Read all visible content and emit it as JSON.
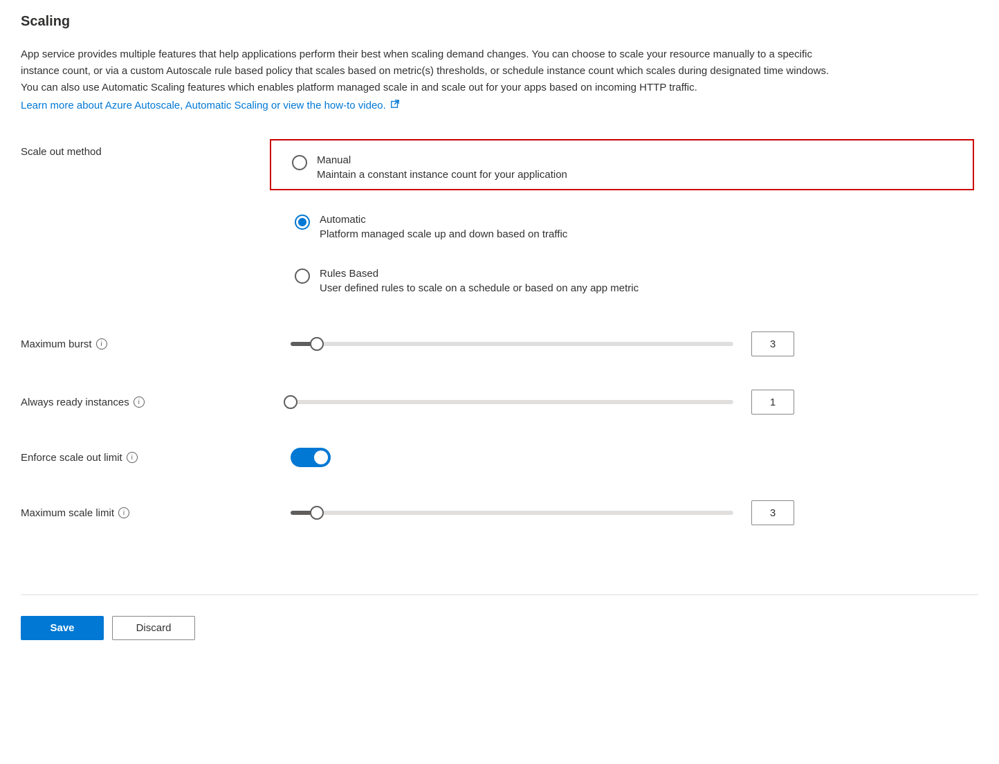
{
  "title": "Scaling",
  "description": "App service provides multiple features that help applications perform their best when scaling demand changes. You can choose to scale your resource manually to a specific instance count, or via a custom Autoscale rule based policy that scales based on metric(s) thresholds, or schedule instance count which scales during designated time windows. You can also use Automatic Scaling features which enables platform managed scale in and scale out for your apps based on incoming HTTP traffic.",
  "learn_more": "Learn more about Azure Autoscale, Automatic Scaling or view the how-to video.",
  "scale_out_method": {
    "label": "Scale out method",
    "options": [
      {
        "title": "Manual",
        "desc": "Maintain a constant instance count for your application",
        "selected": false,
        "highlighted": true
      },
      {
        "title": "Automatic",
        "desc": "Platform managed scale up and down based on traffic",
        "selected": true,
        "highlighted": false
      },
      {
        "title": "Rules Based",
        "desc": "User defined rules to scale on a schedule or based on any app metric",
        "selected": false,
        "highlighted": false
      }
    ]
  },
  "maximum_burst": {
    "label": "Maximum burst",
    "value": "3",
    "slider_percent": 6
  },
  "always_ready": {
    "label": "Always ready instances",
    "value": "1",
    "slider_percent": 0
  },
  "enforce_limit": {
    "label": "Enforce scale out limit",
    "enabled": true
  },
  "maximum_scale_limit": {
    "label": "Maximum scale limit",
    "value": "3",
    "slider_percent": 6
  },
  "buttons": {
    "save": "Save",
    "discard": "Discard"
  }
}
